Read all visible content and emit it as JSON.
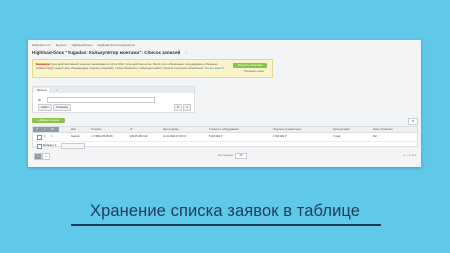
{
  "breadcrumbs": [
    "Рабочий стол",
    "Контент",
    "Highload-блоки",
    "Highload-блок Калькулятор"
  ],
  "page_title": "Highload-блок \"Yugadas: Калькулятор монтажа\": Список записей",
  "notice": {
    "strong": "Внимание!",
    "text": "Срок действия вашей лицензии заканчивается 12.12.2022. Срок действия истек. После этого обновления, техподдержка и облачные сервисы будут недоступны. Рекомендуем продлить лицензию, чтобы обеспечить стабильную работу проекта и получать обновления.",
    "link": "Что это значит?",
    "button": "Продлить лицензию",
    "secondary": "Напомнить позже"
  },
  "filter": {
    "tab_active": "Фильтр",
    "tab_add": "+",
    "id_label": "ID",
    "find_button": "Найти",
    "cancel_button": "Отменить"
  },
  "toolbar": {
    "add_button": "+ Добавить запись"
  },
  "grid": {
    "headers": [
      "ID",
      "Имя",
      "Телефон",
      "IP",
      "Дата и время",
      "Стоимость оборудования",
      "Подключительный заказ",
      "Срок доставки",
      "Заказ обработан"
    ],
    "row": [
      "1",
      "Сергей",
      "+7 (999) 253-95-98",
      "192.25.252.142",
      "21.11.2022 17:33:03",
      "5 000 000 Р",
      "1 500 000 Р",
      "3 года",
      "Нет"
    ],
    "footer_text": "Выбрано: 0"
  },
  "pager": {
    "current": "1",
    "next": "»",
    "per_page_label": "На странице:",
    "per_page": "20",
    "total": "1 — 1 из 1"
  },
  "caption": "Хранение списка заявок в таблице"
}
